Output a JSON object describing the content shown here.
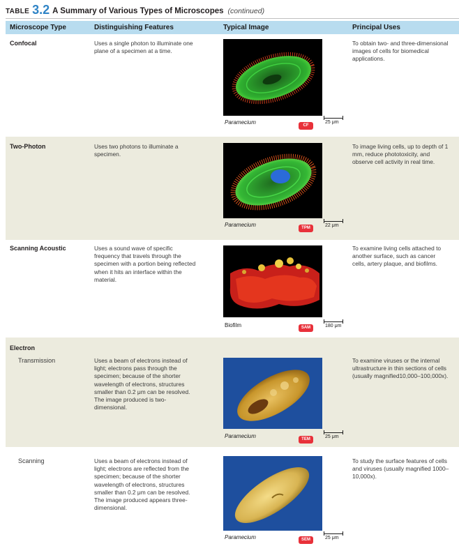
{
  "table": {
    "label": "TABLE",
    "number": "3.2",
    "title": "A Summary of Various Types of Microscopes",
    "continued": "(continued)"
  },
  "headers": {
    "type": "Microscope Type",
    "features": "Distinguishing Features",
    "image": "Typical Image",
    "uses": "Principal Uses"
  },
  "rows": [
    {
      "type": "Confocal",
      "features": "Uses a single photon to illuminate one plane of a specimen at a time.",
      "caption": "Paramecium",
      "badge": "CF",
      "scale": "25 μm",
      "uses": "To obtain two- and three-dimensional images of cells for biomedical applications."
    },
    {
      "type": "Two-Photon",
      "features": "Uses two photons to illuminate a specimen.",
      "caption": "Paramecium",
      "badge": "TPM",
      "scale": "22 μm",
      "uses": "To image living cells, up to depth of 1 mm, reduce phototoxicity, and observe cell activity in real time."
    },
    {
      "type": "Scanning Acoustic",
      "features": "Uses a sound wave of specific frequency that travels through the specimen with a portion being reflected when it hits an interface within the material.",
      "caption": "Biofilm",
      "badge": "SAM",
      "scale": "180 μm",
      "uses": "To examine living cells attached to another surface, such as cancer cells, artery plaque, and biofilms."
    },
    {
      "group": "Electron",
      "type": "Transmission",
      "features": "Uses a beam of electrons instead of light; electrons pass through the specimen; because of the shorter wavelength of electrons, structures smaller than 0.2 μm can be resolved. The image produced is two-dimensional.",
      "caption": "Paramecium",
      "badge": "TEM",
      "scale": "25 μm",
      "uses": "To examine viruses or the internal ultrastructure in thin sections of cells (usually magnified10,000–100,000x)."
    },
    {
      "type": "Scanning",
      "features": "Uses a beam of electrons instead of light; electrons are reflected from the specimen; because of the shorter wavelength of electrons, structures smaller than 0.2 μm can be resolved. The image produced appears three-dimensional.",
      "caption": "Paramecium",
      "badge": "SEM",
      "scale": "25 μm",
      "uses": "To study the surface features of cells and viruses (usually magnified 1000–10,000x)."
    }
  ],
  "colors": {
    "header_bg": "#b8dcef",
    "row_shade": "#ecebde",
    "accent": "#2f84c6",
    "badge": "#e8313a"
  }
}
